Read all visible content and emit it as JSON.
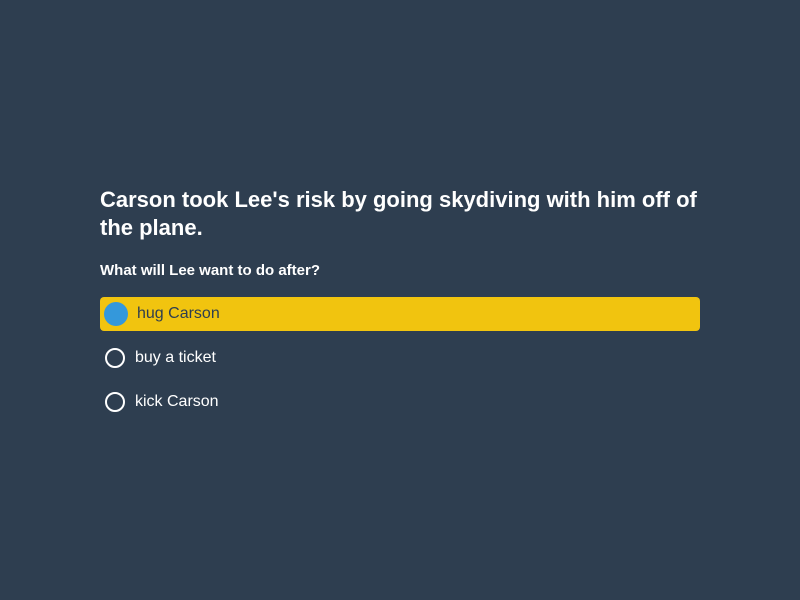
{
  "question": "Carson took Lee's risk by going skydiving with him off of the plane.",
  "prompt": "What will Lee want to do after?",
  "options": [
    {
      "label": "hug Carson",
      "selected": true
    },
    {
      "label": "buy a ticket",
      "selected": false
    },
    {
      "label": "kick Carson",
      "selected": false
    }
  ],
  "colors": {
    "background": "#2e3e50",
    "selected_highlight": "#f1c40f",
    "selected_radio": "#3498db",
    "text": "#ffffff"
  }
}
